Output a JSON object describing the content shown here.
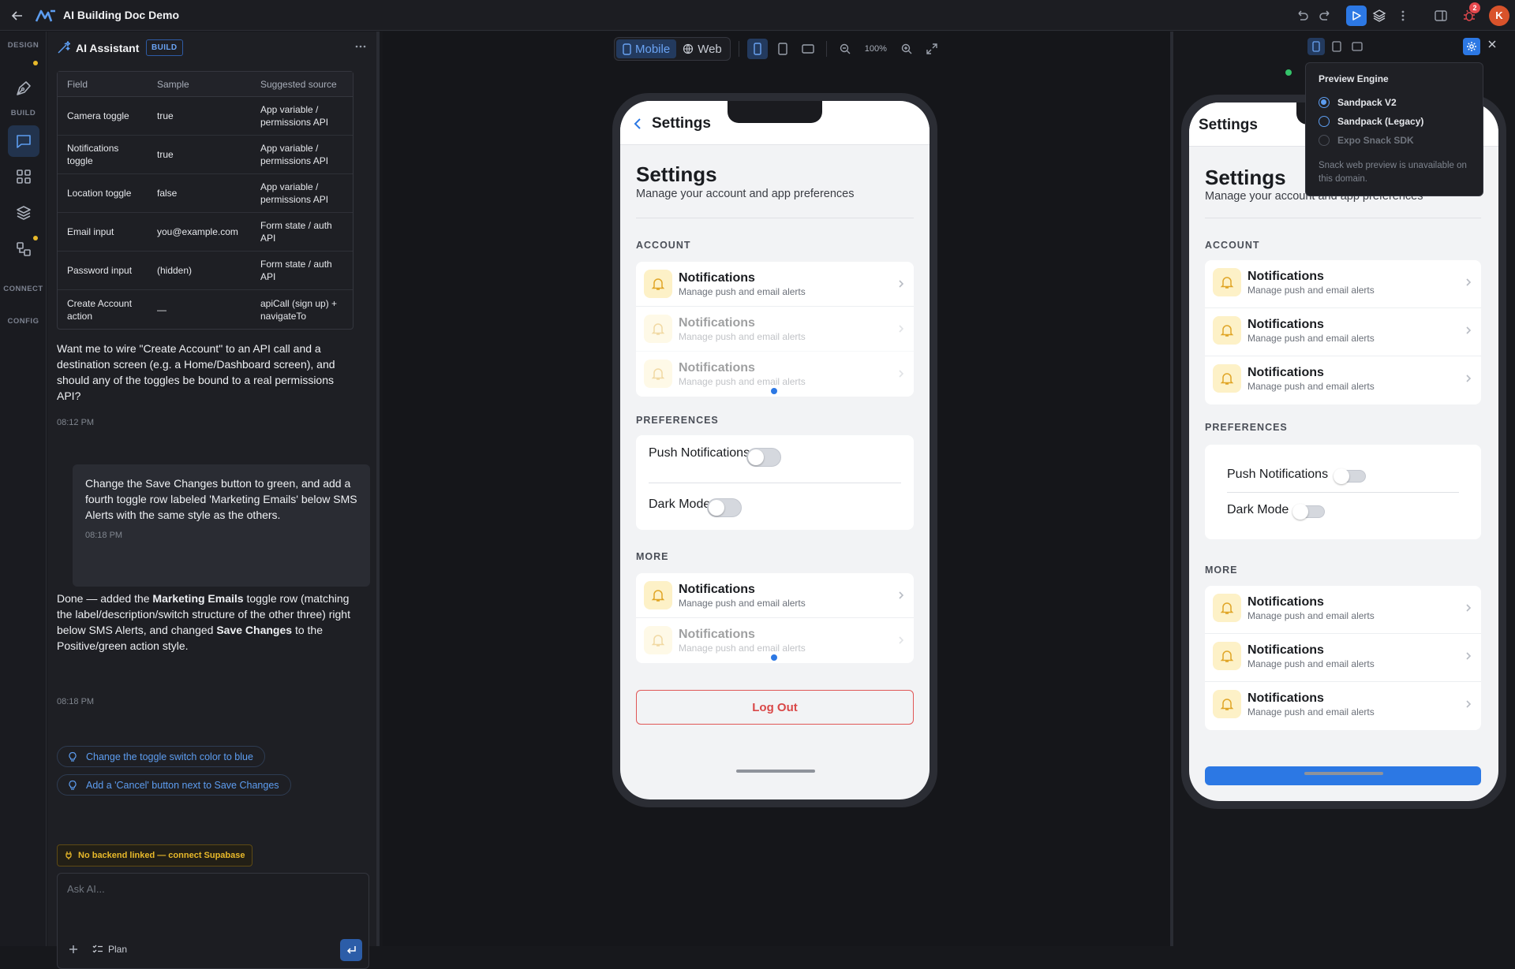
{
  "topbar": {
    "title": "AI Building Doc Demo",
    "notification_count": "2",
    "avatar_initial": "K"
  },
  "rail": {
    "design": "DESIGN",
    "build": "BUILD",
    "connect": "CONNECT",
    "config": "CONFIG"
  },
  "chat": {
    "title": "AI Assistant",
    "badge": "BUILD",
    "table": {
      "headers": [
        "Field",
        "Sample",
        "Suggested source"
      ],
      "rows": [
        [
          "Camera toggle",
          "true",
          "App variable / permissions API"
        ],
        [
          "Notifications toggle",
          "true",
          "App variable / permissions API"
        ],
        [
          "Location toggle",
          "false",
          "App variable / permissions API"
        ],
        [
          "Email input",
          "you@example.com",
          "Form state / auth API"
        ],
        [
          "Password input",
          "(hidden)",
          "Form state / auth API"
        ],
        [
          "Create Account action",
          "—",
          "apiCall (sign up) + navigateTo"
        ]
      ]
    },
    "msg1": "Want me to wire \"Create Account\" to an API call and a destination screen (e.g. a Home/Dashboard screen), and should any of the toggles be bound to a real permissions API?",
    "msg1_time": "08:12 PM",
    "user_msg": "Change the Save Changes button to green, and add a fourth toggle row labeled 'Marketing Emails' below SMS Alerts with the same style as the others.",
    "user_time": "08:18 PM",
    "reply_a": "Done — added the ",
    "reply_b": "Marketing Emails",
    "reply_c": " toggle row (matching the label/description/switch structure of the other three) right below SMS Alerts, and changed ",
    "reply_d": "Save Changes",
    "reply_e": " to the Positive/green action style.",
    "reply_time": "08:18 PM",
    "suggestions": [
      "Change the toggle switch color to blue",
      "Add a 'Cancel' button next to Save Changes"
    ],
    "warning": "No backend linked — connect Supabase",
    "input_placeholder": "Ask AI...",
    "plan_label": "Plan"
  },
  "canvas": {
    "mobile_label": "Mobile",
    "web_label": "Web",
    "zoom": "100%",
    "phone": {
      "nav_title": "Settings",
      "heading": "Settings",
      "subheading": "Manage your account and app preferences",
      "account_label": "ACCOUNT",
      "preferences_label": "PREFERENCES",
      "more_label": "MORE",
      "row_title": "Notifications",
      "row_subtitle": "Manage push and email alerts",
      "push_label": "Push Notifications",
      "dark_label": "Dark Mode",
      "logout": "Log Out"
    }
  },
  "preview": {
    "nav_title": "Settings",
    "heading": "Settings",
    "subheading": "Manage your account and app preferences",
    "account_label": "ACCOUNT",
    "preferences_label": "PREFERENCES",
    "more_label": "MORE",
    "row_title": "Notifications",
    "row_subtitle": "Manage push and email alerts",
    "push_label": "Push Notifications",
    "dark_label": "Dark Mode",
    "engine": {
      "title": "Preview Engine",
      "options": [
        "Sandpack V2",
        "Sandpack (Legacy)",
        "Expo Snack SDK"
      ],
      "selected": "Sandpack V2",
      "note": "Snack web preview is unavailable on this domain."
    }
  },
  "colors": {
    "accent": "#2c78e4",
    "warning": "#e8b92a",
    "danger": "#d94848",
    "bell_bg": "#fdf1c7"
  }
}
